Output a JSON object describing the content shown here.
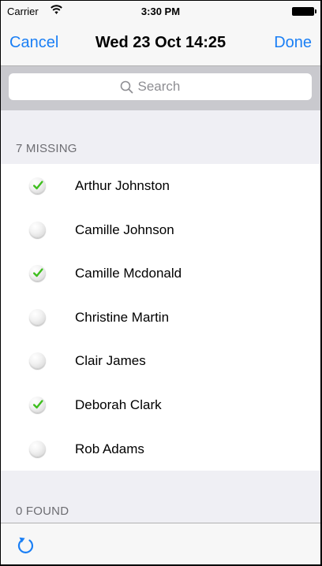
{
  "status_bar": {
    "carrier": "Carrier",
    "time": "3:30 PM"
  },
  "nav": {
    "cancel_label": "Cancel",
    "title": "Wed 23 Oct 14:25",
    "done_label": "Done"
  },
  "search": {
    "placeholder": "Search"
  },
  "sections": {
    "missing_header": "7 MISSING",
    "found_header": "0 FOUND"
  },
  "people": [
    {
      "name": "Arthur Johnston",
      "checked": true
    },
    {
      "name": "Camille Johnson",
      "checked": false
    },
    {
      "name": "Camille Mcdonald",
      "checked": true
    },
    {
      "name": "Christine Martin",
      "checked": false
    },
    {
      "name": "Clair James",
      "checked": false
    },
    {
      "name": "Deborah Clark",
      "checked": true
    },
    {
      "name": "Rob Adams",
      "checked": false
    }
  ],
  "icons": {
    "check": "check-icon",
    "refresh": "refresh-icon",
    "search": "search-icon",
    "wifi": "wifi-icon",
    "battery": "battery-icon"
  },
  "colors": {
    "accent": "#1a7ff5",
    "check": "#3fbf1f"
  }
}
